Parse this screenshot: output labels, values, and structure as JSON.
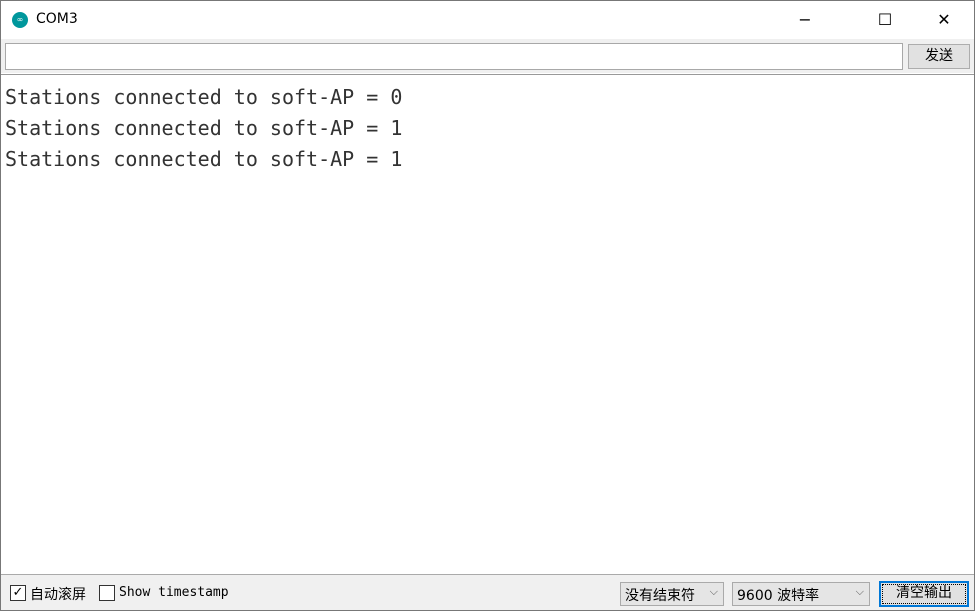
{
  "window": {
    "title": "COM3",
    "minimize": "−",
    "maximize": "☐",
    "close": "✕"
  },
  "toolbar": {
    "input_value": "",
    "send_label": "发送"
  },
  "output": {
    "lines": [
      "Stations connected to soft-AP = 0",
      "Stations connected to soft-AP = 1",
      "Stations connected to soft-AP = 1"
    ]
  },
  "footer": {
    "autoscroll_label": "自动滚屏",
    "autoscroll_checked": true,
    "check_mark": "✓",
    "timestamp_label": "Show timestamp",
    "timestamp_checked": false,
    "line_ending": "没有结束符",
    "baud_rate": "9600 波特率",
    "clear_label": "清空输出",
    "chevron": "⌵"
  }
}
